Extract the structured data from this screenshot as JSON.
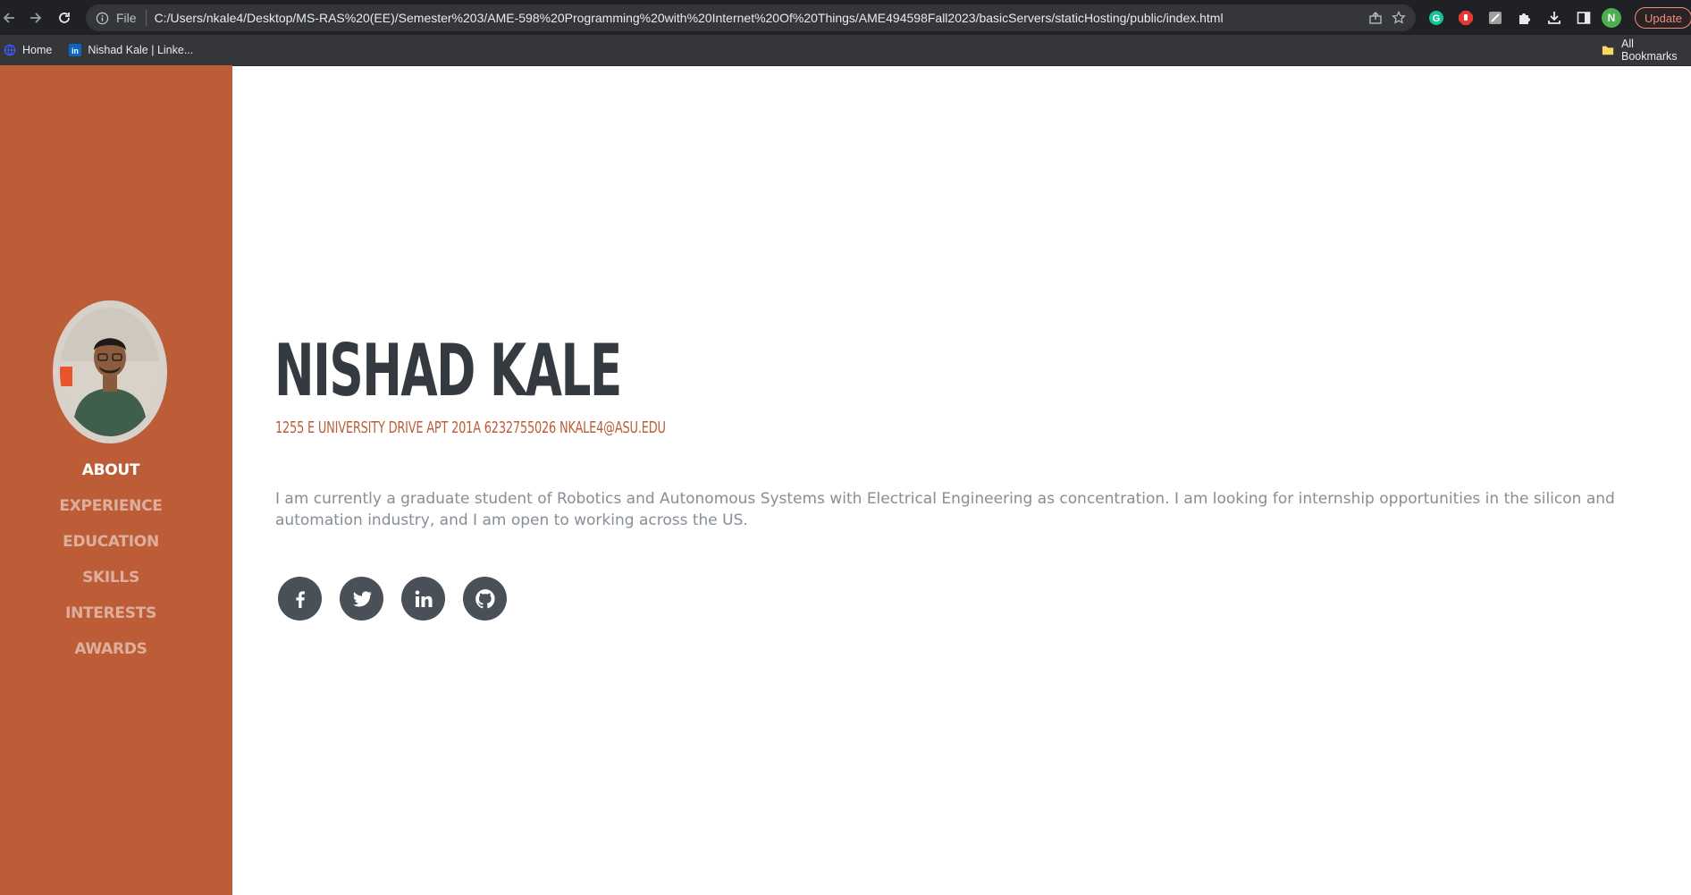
{
  "browser": {
    "scheme_label": "File",
    "url": "C:/Users/nkale4/Desktop/MS-RAS%20(EE)/Semester%203/AME-598%20Programming%20with%20Internet%20Of%20Things/AME494598Fall2023/basicServers/staticHosting/public/index.html",
    "profile_initial": "N",
    "update_label": "Update",
    "bookmarks": [
      {
        "label": "Home",
        "icon": "globe-icon"
      },
      {
        "label": "Nishad Kale | Linke...",
        "icon": "linkedin-icon"
      }
    ],
    "all_bookmarks_label": "All Bookmarks"
  },
  "sidebar": {
    "nav": [
      {
        "label": "About",
        "active": true
      },
      {
        "label": "Experience",
        "active": false
      },
      {
        "label": "Education",
        "active": false
      },
      {
        "label": "Skills",
        "active": false
      },
      {
        "label": "Interests",
        "active": false
      },
      {
        "label": "Awards",
        "active": false
      }
    ]
  },
  "about": {
    "name": "NISHAD KALE",
    "subheading": "1255 E UNIVERSITY DRIVE APT 201A 6232755026 NKALE4@ASU.EDU",
    "lead": "I am currently a graduate student of Robotics and Autonomous Systems with Electrical Engineering as concentration. I am looking for internship opportunities in the silicon and automation industry, and I am open to working across the US."
  },
  "social": [
    "facebook-icon",
    "twitter-icon",
    "linkedin-icon",
    "github-icon"
  ],
  "colors": {
    "accent": "#bd5d38",
    "heading": "#343a40",
    "lead": "#868e96",
    "social_bg": "#495057",
    "chrome_bg": "#202124",
    "omnibox_bg": "#35363a"
  }
}
